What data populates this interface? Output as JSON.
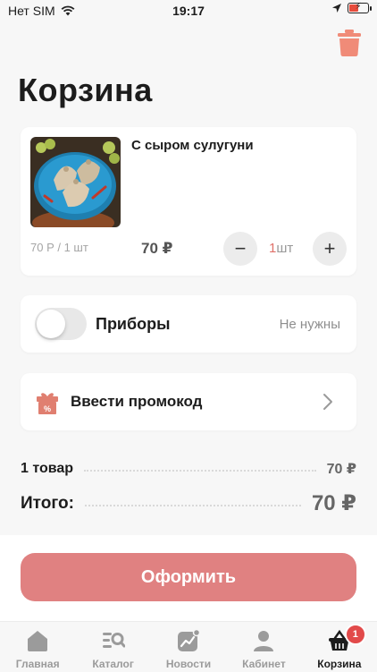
{
  "status_bar": {
    "carrier": "Нет SIM",
    "time": "19:17"
  },
  "page": {
    "title": "Корзина"
  },
  "cart_items": [
    {
      "name": "С сыром сулугуни",
      "unit_price": "70 Р / 1 шт",
      "price": "70 ₽",
      "quantity": "1",
      "quantity_unit": "шт"
    }
  ],
  "cutlery": {
    "label": "Приборы",
    "status": "Не нужны",
    "enabled": false
  },
  "promo": {
    "label": "Ввести промокод"
  },
  "summary": {
    "items_label": "1 товар",
    "items_value": "70 ₽",
    "total_label": "Итого:",
    "total_value": "70 ₽"
  },
  "checkout": {
    "label": "Оформить"
  },
  "tabbar": {
    "tabs": [
      {
        "label": "Главная",
        "icon": "home-icon"
      },
      {
        "label": "Каталог",
        "icon": "catalog-icon"
      },
      {
        "label": "Новости",
        "icon": "news-icon"
      },
      {
        "label": "Кабинет",
        "icon": "profile-icon"
      },
      {
        "label": "Корзина",
        "icon": "basket-icon",
        "active": true,
        "badge": "1"
      }
    ]
  },
  "colors": {
    "accent": "#e08181",
    "badge": "#e24a4a",
    "trash": "#f08b78",
    "qty": "#e0716a"
  }
}
